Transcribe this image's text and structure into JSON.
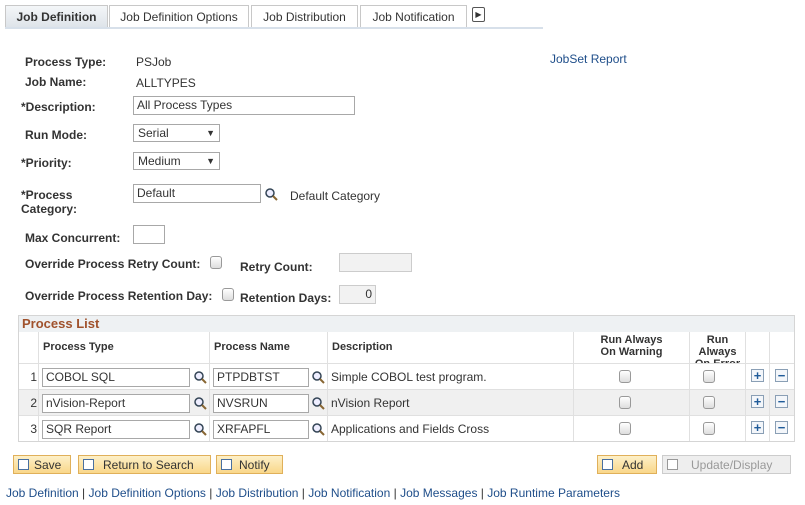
{
  "tabs": [
    {
      "label": "Job Definition",
      "active": true
    },
    {
      "label": "Job Definition Options"
    },
    {
      "label": "Job Distribution"
    },
    {
      "label": "Job Notification"
    }
  ],
  "form": {
    "process_type_label": "Process Type:",
    "process_type": "PSJob",
    "job_name_label": "Job Name:",
    "job_name": "ALLTYPES",
    "jobset_report_link": "JobSet Report",
    "description_label": "*Description:",
    "description": "All Process Types",
    "run_mode_label": "Run Mode:",
    "run_mode": "Serial",
    "priority_label": "*Priority:",
    "priority": "Medium",
    "process_category_label": "*Process Category:",
    "process_category": "Default",
    "process_category_desc": "Default Category",
    "max_concurrent_label": "Max Concurrent:",
    "max_concurrent": "",
    "override_retry_label": "Override Process Retry Count:",
    "retry_count_label": "Retry Count:",
    "retry_count": "",
    "override_retention_label": "Override Process Retention Day:",
    "retention_days_label": "Retention Days:",
    "retention_days": "0"
  },
  "grid": {
    "title": "Process List",
    "headers": {
      "process_type": "Process Type",
      "process_name": "Process Name",
      "description": "Description",
      "run_warning": "Run Always On Warning",
      "run_error": "Run Always On Error"
    },
    "rows": [
      {
        "num": "1",
        "process_type": "COBOL SQL",
        "process_name": "PTPDBTST",
        "description": "Simple COBOL test program."
      },
      {
        "num": "2",
        "process_type": "nVision-Report",
        "process_name": "NVSRUN",
        "description": "nVision Report"
      },
      {
        "num": "3",
        "process_type": "SQR Report",
        "process_name": "XRFAPFL",
        "description": "Applications and Fields Cross"
      }
    ]
  },
  "buttons": {
    "save": "Save",
    "return": "Return to Search",
    "notify": "Notify",
    "add": "Add",
    "update": "Update/Display"
  },
  "footer_links": [
    "Job Definition",
    "Job Definition Options",
    "Job Distribution",
    "Job Notification",
    "Job Messages",
    "Job Runtime Parameters"
  ]
}
